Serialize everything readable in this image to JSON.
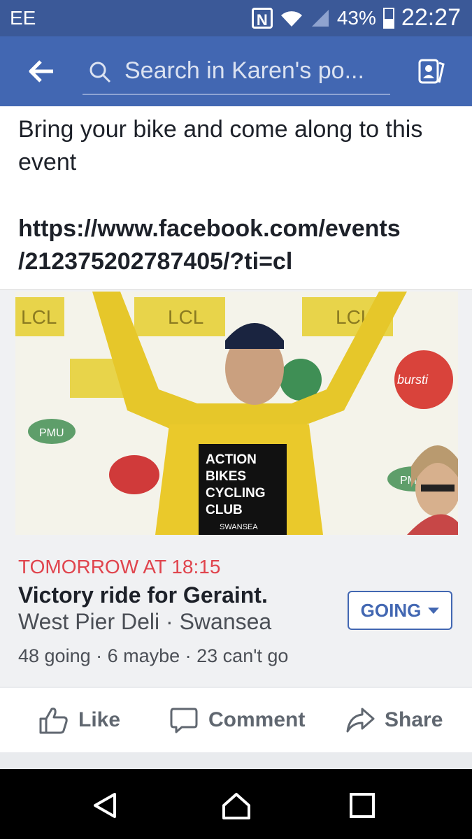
{
  "status": {
    "carrier": "EE",
    "nfc": "N",
    "battery": "43%",
    "time": "22:27"
  },
  "search": {
    "placeholder": "Search in Karen's po..."
  },
  "post": {
    "message": "Bring your bike and come along to this event",
    "link_line1": "https://www.facebook.com/events",
    "link_line2": "/212375202787405/?ti=cl"
  },
  "photo": {
    "sign_line1": "ACTION",
    "sign_line2": "BIKES",
    "sign_line3": "CYCLING",
    "sign_line4": "CLUB",
    "sign_line5": "SWANSEA",
    "sponsor1": "LCL",
    "sponsor2": "PMU",
    "sponsor3": "bursti"
  },
  "event": {
    "date": "TOMORROW AT 18:15",
    "title": "Victory ride for Geraint.",
    "place": "West Pier Deli · Swansea",
    "counts": "48 going · 6 maybe · 23 can't go",
    "rsvp_label": "GOING"
  },
  "actions": {
    "like": "Like",
    "comment": "Comment",
    "share": "Share"
  },
  "colors": {
    "brand": "#4267b2",
    "date_red": "#e0444d"
  }
}
